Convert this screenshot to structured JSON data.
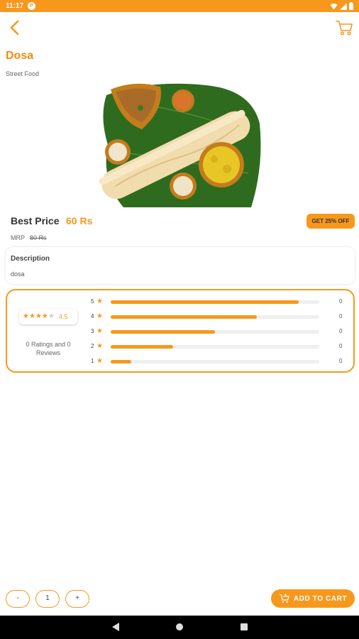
{
  "status_bar": {
    "time": "11:17",
    "badge": "P"
  },
  "header": {
    "back_icon": "chevron-left-icon",
    "cart_icon": "cart-icon"
  },
  "product": {
    "name": "Dosa",
    "category": "Street Food",
    "best_price_label": "Best Price",
    "best_price": "60 Rs",
    "discount_badge": "GET 25% OFF",
    "mrp_label": "MRP",
    "mrp": "80 Rs"
  },
  "description": {
    "heading": "Description",
    "text": "dosa"
  },
  "ratings": {
    "average": "4.5",
    "average_stars": 4.5,
    "summary": "0 Ratings and 0 Reviews",
    "breakdown": [
      {
        "stars": "5",
        "count": "0",
        "fill": 0.9
      },
      {
        "stars": "4",
        "count": "0",
        "fill": 0.7
      },
      {
        "stars": "3",
        "count": "0",
        "fill": 0.5
      },
      {
        "stars": "2",
        "count": "0",
        "fill": 0.3
      },
      {
        "stars": "1",
        "count": "0",
        "fill": 0.1
      }
    ]
  },
  "cart_controls": {
    "decrement_label": "-",
    "quantity": "1",
    "increment_label": "+",
    "add_to_cart_label": "ADD TO CART"
  },
  "colors": {
    "accent": "#f7981d",
    "title": "#f28c0f"
  }
}
